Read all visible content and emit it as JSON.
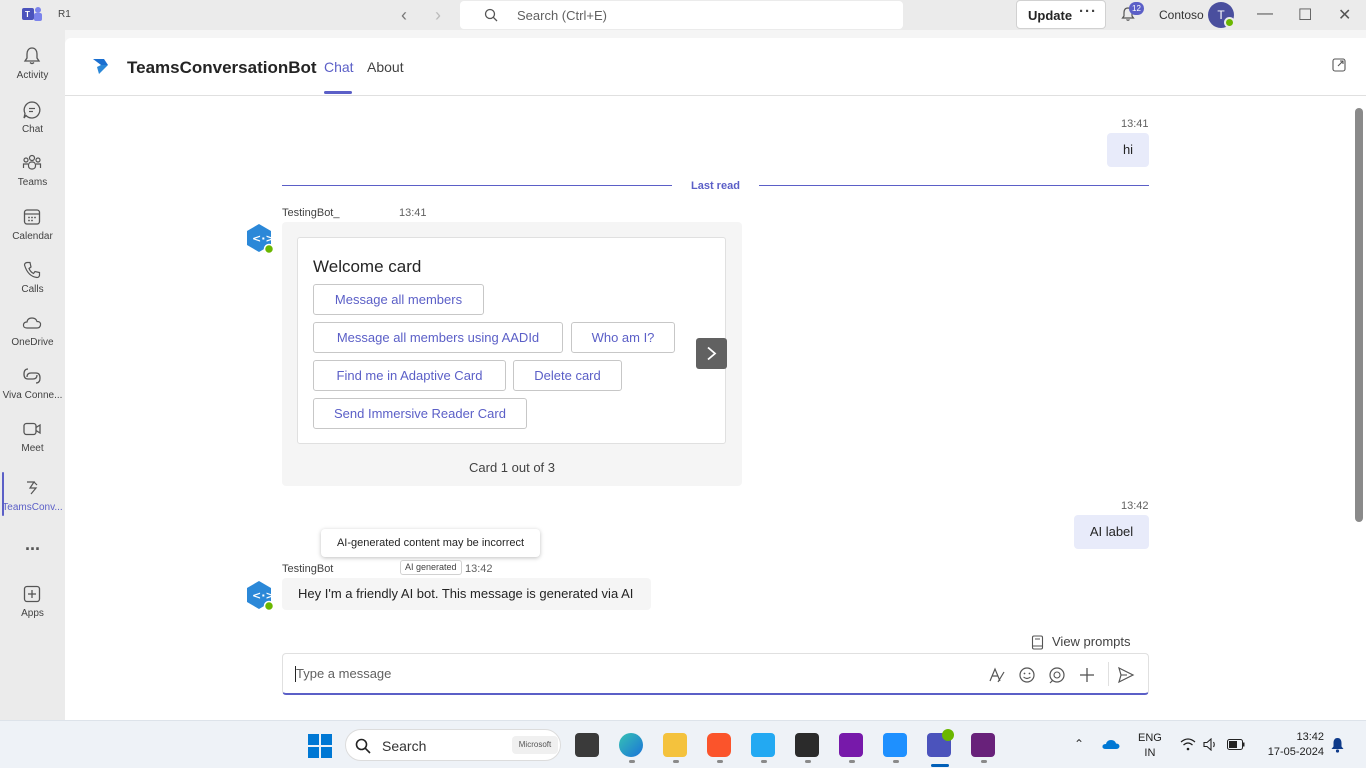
{
  "titlebar": {
    "profile_badge": "R1",
    "search_placeholder": "Search (Ctrl+E)",
    "update_label": "Update",
    "more_label": "···",
    "notification_count": "12",
    "org_name": "Contoso",
    "avatar_initial": "T"
  },
  "rail": {
    "items": [
      {
        "label": "Activity",
        "icon": "bell-icon"
      },
      {
        "label": "Chat",
        "icon": "chat-icon"
      },
      {
        "label": "Teams",
        "icon": "teams-icon"
      },
      {
        "label": "Calendar",
        "icon": "calendar-icon"
      },
      {
        "label": "Calls",
        "icon": "phone-icon"
      },
      {
        "label": "OneDrive",
        "icon": "cloud-icon"
      },
      {
        "label": "Viva Conne...",
        "icon": "viva-icon"
      },
      {
        "label": "Meet",
        "icon": "video-icon"
      },
      {
        "label": "TeamsConv...",
        "icon": "bot-app-icon"
      },
      {
        "label": "...",
        "icon": "more-icon"
      },
      {
        "label": "Apps",
        "icon": "apps-icon"
      }
    ]
  },
  "header": {
    "app_title": "TeamsConversationBot",
    "tabs": [
      {
        "label": "Chat",
        "active": true
      },
      {
        "label": "About",
        "active": false
      }
    ]
  },
  "conversation": {
    "msg1": {
      "time": "13:41",
      "text": "hi"
    },
    "last_read_label": "Last read",
    "bot_msg1": {
      "sender": "TestingBot_",
      "time": "13:41",
      "card": {
        "title": "Welcome card",
        "buttons": [
          "Message all members",
          "Message all members using AADId",
          "Who am I?",
          "Find me in Adaptive Card",
          "Delete card",
          "Send Immersive Reader Card"
        ],
        "counter": "Card 1 out of 3"
      }
    },
    "msg2": {
      "time": "13:42",
      "text": "AI label"
    },
    "tooltip": "AI-generated content may be incorrect",
    "bot_msg2": {
      "sender": "TestingBot",
      "badge": "AI generated",
      "time": "13:42",
      "text": "Hey I'm a friendly AI bot. This message is generated via AI"
    }
  },
  "composer": {
    "view_prompts": "View prompts",
    "placeholder": "Type a message"
  },
  "taskbar": {
    "search_label": "Search",
    "search_badge": "Microsoft",
    "lang_top": "ENG",
    "lang_bottom": "IN",
    "time": "13:42",
    "date": "17-05-2024"
  },
  "colors": {
    "accent": "#5b5fc7",
    "my_bubble": "#e8ebfa",
    "online": "#6bb700"
  }
}
